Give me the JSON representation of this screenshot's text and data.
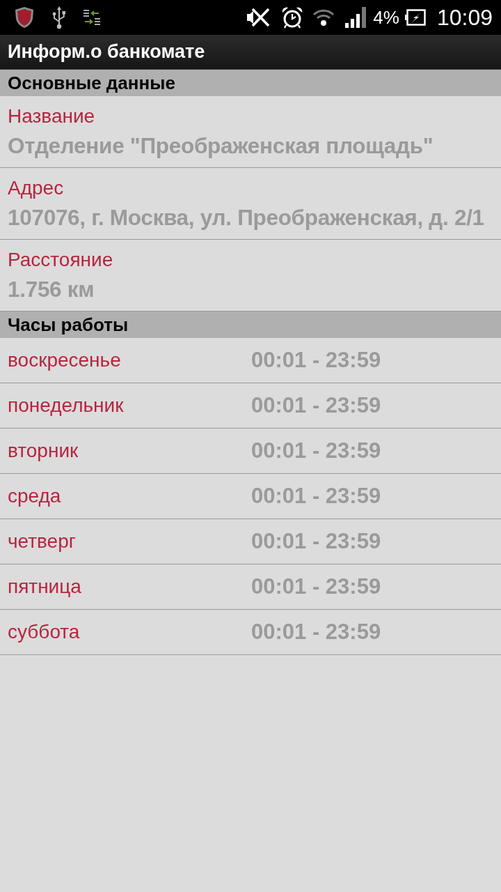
{
  "status_bar": {
    "battery": "4%",
    "time": "10:09"
  },
  "title_bar": {
    "title": "Информ.о банкомате"
  },
  "sections": [
    {
      "kind": "fields",
      "title": "Основные данные",
      "items": [
        {
          "label": "Название",
          "value": "Отделение \"Преображенская площадь\""
        },
        {
          "label": "Адрес",
          "value": "107076, г. Москва, ул. Преображенская, д. 2/1"
        },
        {
          "label": "Расстояние",
          "value": "1.756 км"
        }
      ]
    },
    {
      "kind": "hours",
      "title": "Часы работы",
      "items": [
        {
          "day": "воскресенье",
          "hours": "00:01 - 23:59"
        },
        {
          "day": "понедельник",
          "hours": "00:01 - 23:59"
        },
        {
          "day": "вторник",
          "hours": "00:01 - 23:59"
        },
        {
          "day": "среда",
          "hours": "00:01 - 23:59"
        },
        {
          "day": "четверг",
          "hours": "00:01 - 23:59"
        },
        {
          "day": "пятница",
          "hours": "00:01 - 23:59"
        },
        {
          "day": "суббота",
          "hours": "00:01 - 23:59"
        }
      ]
    }
  ]
}
